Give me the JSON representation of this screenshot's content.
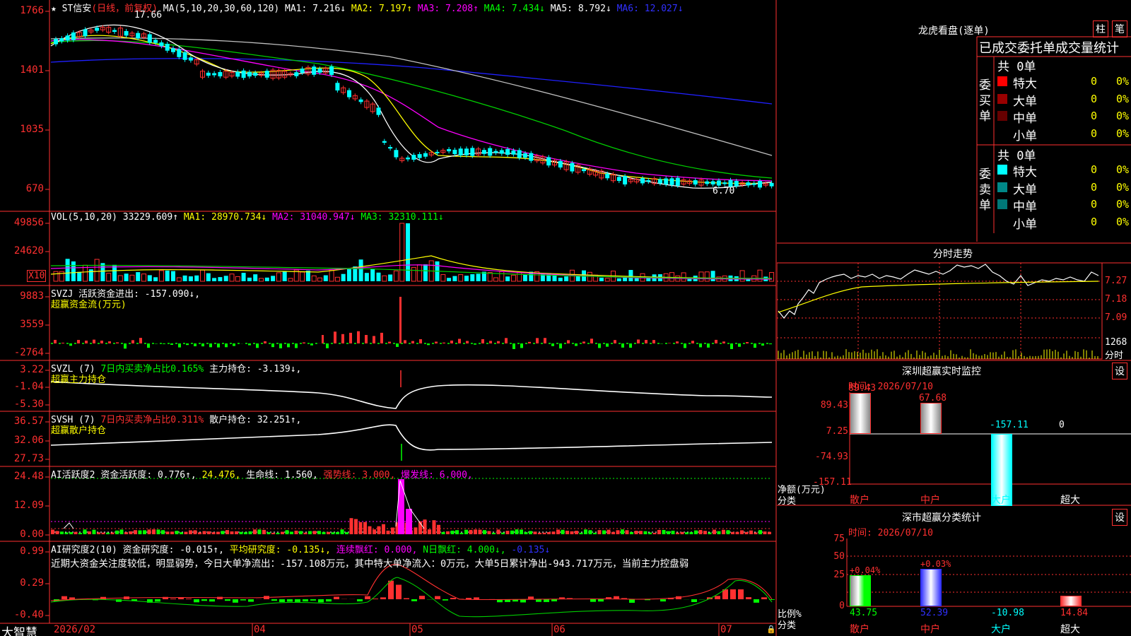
{
  "main": {
    "security": "ST信安",
    "period": "(日线，前复权)",
    "ma_params": "MA(5,10,20,30,60,120)",
    "ma1": "MA1: 7.216↓",
    "ma2": "MA2: 7.197↑",
    "ma3": "MA3: 7.208↑",
    "ma4": "MA4: 7.434↓",
    "ma5": "MA5: 8.792↓",
    "ma6": "MA6: 12.027↓",
    "y_ticks": [
      "1766",
      "1401",
      "1035",
      "670"
    ],
    "high_label": "17.66",
    "low_label": "6.70",
    "star": "★"
  },
  "vol": {
    "params": "VOL(5,10,20)",
    "v": "33229.609↑",
    "ma1": "MA1: 28970.734↓",
    "ma2": "MA2: 31040.947↓",
    "ma3": "MA3: 32310.111↓",
    "y_ticks": [
      "49856",
      "24620"
    ],
    "unit": "X10"
  },
  "svzj": {
    "line1a": "SVZJ",
    "line1b": "活跃资金进出: -157.090↓,",
    "line2": "超赢资金流(万元)",
    "y_ticks": [
      "9883",
      "3559",
      "-2764"
    ]
  },
  "svzl": {
    "line1a": "SVZL (7)",
    "line1b": "7日内买卖净占比0.165%",
    "line1c": "主力持仓: -3.139↓,",
    "line2": "超赢主力持仓",
    "y_ticks": [
      "3.22",
      "-1.04",
      "-5.30"
    ]
  },
  "svsh": {
    "line1a": "SVSH (7)",
    "line1b": "7日内买卖净占比0.311%",
    "line1c": "散户持仓: 32.251↑,",
    "line2": "超赢散户持仓",
    "y_ticks": [
      "36.57",
      "32.06",
      "27.73"
    ]
  },
  "ai1": {
    "a": "AI活跃度2",
    "b": "资金活跃度: 0.776↑,",
    "c": "24.476,",
    "d": "生命线: 1.560,",
    "e": "强势线: 3.000,",
    "f": "爆发线: 6.000,",
    "y_ticks": [
      "24.48",
      "12.09",
      "0.00"
    ]
  },
  "ai2": {
    "a": "AI研究度2(10)",
    "b": "资金研究度: -0.015↑,",
    "c": "平均研究度: -0.135↓,",
    "d": "连续飘红: 0.000,",
    "e": "N日飘红: 4.000↓,",
    "f": "-0.135↓",
    "comment": "近期大资金关注度较低，明显弱势，今日大单净流出：-157.108万元，其中特大单净流入：0万元，大单5日累计净出-943.717万元，当前主力控盘弱",
    "y_ticks": [
      "0.99",
      "0.29",
      "-0.40"
    ]
  },
  "dates": {
    "brand": "大智慧",
    "labels": [
      "2026/02",
      "04",
      "05",
      "06",
      "07"
    ]
  },
  "dragon": {
    "title": "龙虎看盘(逐单)",
    "btn1": "柱",
    "btn2": "笔",
    "stat_title": "已成交委托单成交量统计",
    "buy_label": "委买单",
    "sell_label": "委卖单",
    "buy_total": "共 0单",
    "sell_total": "共 0单",
    "buy_rows": [
      {
        "name": "特大",
        "val": "0",
        "pct": "0%",
        "color": "#ff0000"
      },
      {
        "name": "大单",
        "val": "0",
        "pct": "0%",
        "color": "#990000"
      },
      {
        "name": "中单",
        "val": "0",
        "pct": "0%",
        "color": "#660000"
      },
      {
        "name": "小单",
        "val": "0",
        "pct": "0%",
        "color": ""
      }
    ],
    "sell_rows": [
      {
        "name": "特大",
        "val": "0",
        "pct": "0%",
        "color": "#00ffff"
      },
      {
        "name": "大单",
        "val": "0",
        "pct": "0%",
        "color": "#008888"
      },
      {
        "name": "中单",
        "val": "0",
        "pct": "0%",
        "color": "#007777"
      },
      {
        "name": "小单",
        "val": "0",
        "pct": "0%",
        "color": ""
      }
    ]
  },
  "intraday": {
    "title": "分时走势",
    "ticks": [
      "7.27",
      "7.18",
      "7.09"
    ],
    "vol_tick": "1268",
    "vol_unit": "分时"
  },
  "monitor": {
    "title": "深圳超赢实时监控",
    "btn": "设",
    "time": "时间: 2026/07/10",
    "y_ticks": [
      "89.43",
      "7.25",
      "-74.93",
      "-157.11"
    ],
    "ylabel": "净额(万元)",
    "xlabel": "分类",
    "cats": [
      "散户",
      "中户",
      "大户",
      "超大"
    ],
    "values": [
      "89.43",
      "67.68",
      "-157.11",
      "0"
    ]
  },
  "classify": {
    "title": "深市超赢分类统计",
    "btn": "设",
    "time": "时间: 2026/07/10",
    "y_ticks": [
      "75",
      "50",
      "25",
      "0"
    ],
    "ylabel": "比例%",
    "xlabel": "分类",
    "cats": [
      "散户",
      "中户",
      "大户",
      "超大"
    ],
    "tops": [
      "+0.04%",
      "+0.03%"
    ],
    "values": [
      "43.75",
      "52.39",
      "-10.98",
      "14.84"
    ]
  },
  "colors": {
    "up": "#ff3030",
    "down": "#00ffff",
    "grid": "#ff3030"
  }
}
